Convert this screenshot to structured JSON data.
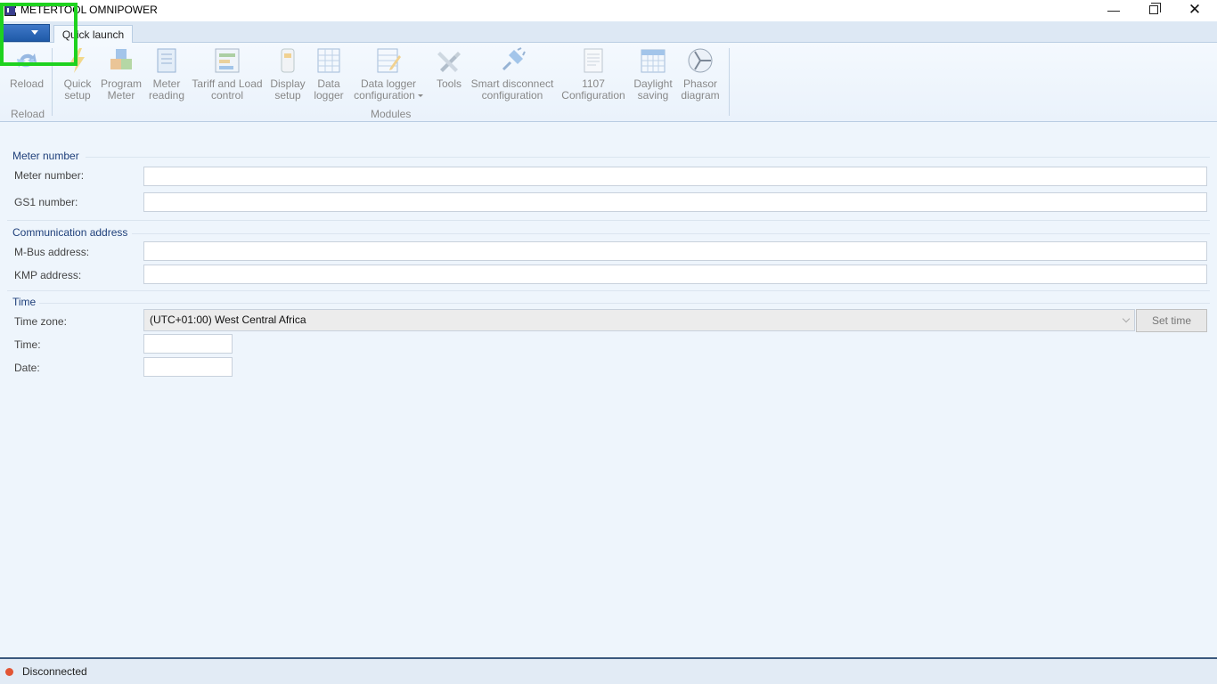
{
  "window": {
    "title": "METERTOOL OMNIPOWER",
    "minimize_glyph": "—",
    "close_glyph": "✕"
  },
  "tabs": [
    {
      "label": "Quick launch"
    }
  ],
  "ribbon": {
    "groups": [
      {
        "label": "Reload"
      },
      {
        "label": "Modules"
      }
    ],
    "buttons": [
      {
        "label": "Reload",
        "icon": "reload-icon"
      },
      {
        "label": "Quick setup",
        "icon": "lightning-icon"
      },
      {
        "label": "Program Meter",
        "icon": "boxes-icon"
      },
      {
        "label": "Meter reading",
        "icon": "notebook-icon"
      },
      {
        "label": "Tariff and Load control",
        "icon": "tariff-icon"
      },
      {
        "label": "Display setup",
        "icon": "meter-device-icon"
      },
      {
        "label": "Data logger",
        "icon": "grid-sheet-icon"
      },
      {
        "label": "Data logger configuration",
        "icon": "edit-sheet-icon"
      },
      {
        "label": "Tools",
        "icon": "tools-icon"
      },
      {
        "label": "Smart disconnect configuration",
        "icon": "plug-icon"
      },
      {
        "label": "1107 Configuration",
        "icon": "document-icon"
      },
      {
        "label": "Daylight saving",
        "icon": "calendar-icon"
      },
      {
        "label": "Phasor diagram",
        "icon": "phasor-icon"
      }
    ]
  },
  "sections": [
    {
      "title": "Meter number",
      "fields": [
        {
          "label": "Meter number:",
          "value": ""
        },
        {
          "label": "GS1 number:",
          "value": ""
        }
      ]
    },
    {
      "title": "Communication address",
      "fields": [
        {
          "label": "M-Bus address:",
          "value": ""
        },
        {
          "label": "KMP address:",
          "value": ""
        }
      ]
    },
    {
      "title": "Time",
      "fields": [
        {
          "label": "Time zone:",
          "value": "(UTC+01:00) West Central Africa"
        },
        {
          "label": "Time:",
          "value": ""
        },
        {
          "label": "Date:",
          "value": ""
        }
      ],
      "set_time_label": "Set time"
    }
  ],
  "status": {
    "text": "Disconnected",
    "color": "#e25534"
  },
  "colors": {
    "accent": "#1f5aa8",
    "highlight": "#1fd21f"
  }
}
